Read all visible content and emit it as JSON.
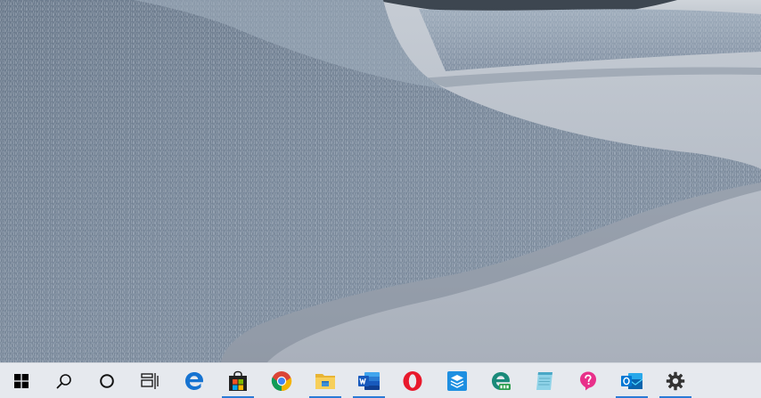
{
  "taskbar": {
    "accent": "#2b7bd6",
    "items": [
      {
        "name": "start",
        "icon": "windows-logo-icon",
        "running": false
      },
      {
        "name": "search",
        "icon": "search-icon",
        "running": false
      },
      {
        "name": "cortana",
        "icon": "cortana-ring-icon",
        "running": false
      },
      {
        "name": "task-view",
        "icon": "task-view-icon",
        "running": false
      },
      {
        "name": "edge",
        "icon": "edge-icon",
        "running": false
      },
      {
        "name": "store",
        "icon": "store-bag-icon",
        "running": true
      },
      {
        "name": "chrome",
        "icon": "chrome-icon",
        "running": false
      },
      {
        "name": "file-explorer",
        "icon": "folder-icon",
        "running": true
      },
      {
        "name": "word",
        "icon": "word-icon",
        "running": true
      },
      {
        "name": "opera",
        "icon": "opera-icon",
        "running": false
      },
      {
        "name": "mixed-app",
        "icon": "stack-box-icon",
        "running": false
      },
      {
        "name": "edge-dev",
        "icon": "edge-dev-icon",
        "running": false
      },
      {
        "name": "notepad",
        "icon": "notepad-icon",
        "running": false
      },
      {
        "name": "tips",
        "icon": "tips-icon",
        "running": false
      },
      {
        "name": "outlook",
        "icon": "outlook-icon",
        "running": true
      },
      {
        "name": "settings",
        "icon": "gear-icon",
        "running": true
      }
    ]
  }
}
